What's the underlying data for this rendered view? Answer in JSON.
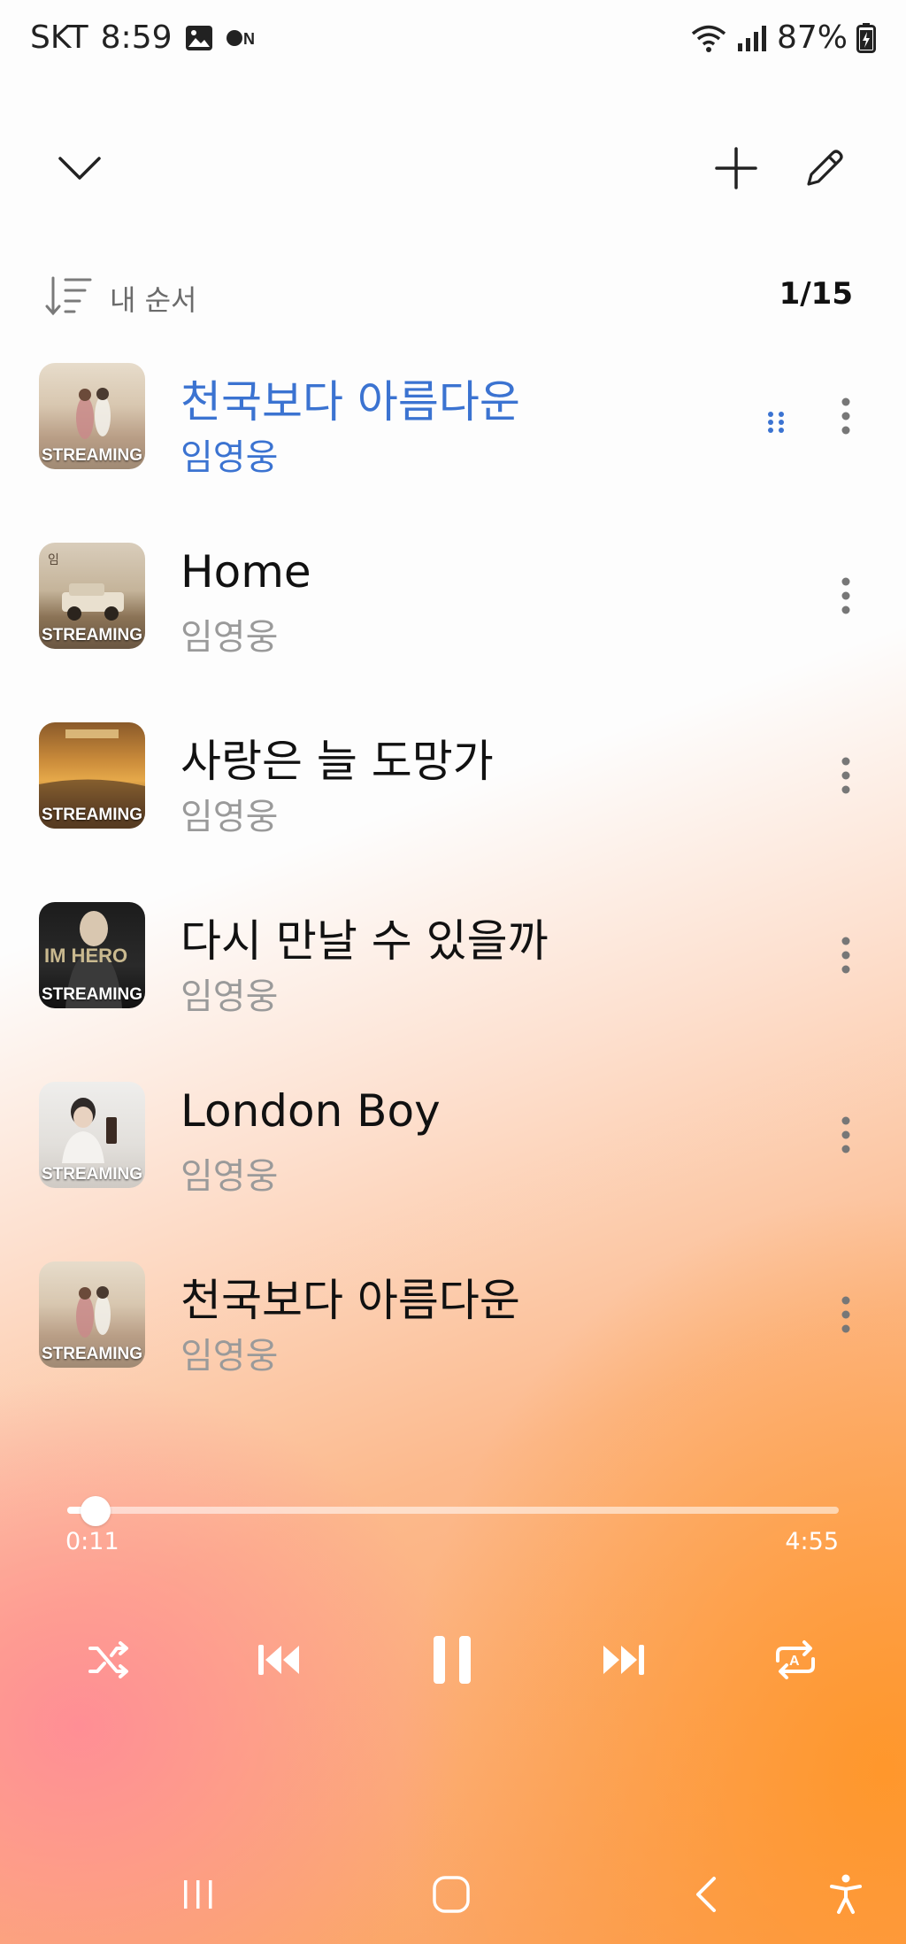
{
  "status_bar": {
    "carrier": "SKT",
    "time": "8:59",
    "battery": "87%",
    "icons": [
      "gallery-icon",
      "on-icon",
      "wifi-icon",
      "signal-icon",
      "battery-icon"
    ]
  },
  "toolbar": {
    "icons": [
      "chevron-down-icon",
      "plus-icon",
      "pencil-icon"
    ]
  },
  "sort": {
    "label": "내 순서",
    "count": "1/15"
  },
  "tracks": [
    {
      "title": "천국보다 아름다운",
      "artist": "임영웅",
      "badge": "STREAMING",
      "active": true
    },
    {
      "title": "Home",
      "artist": "임영웅",
      "badge": "STREAMING",
      "active": false
    },
    {
      "title": "사랑은 늘 도망가",
      "artist": "임영웅",
      "badge": "STREAMING",
      "active": false
    },
    {
      "title": "다시 만날 수 있을까",
      "artist": "임영웅",
      "badge": "STREAMING",
      "active": false
    },
    {
      "title": "London Boy",
      "artist": "임영웅",
      "badge": "STREAMING",
      "active": false
    },
    {
      "title": "천국보다 아름다운",
      "artist": "임영웅",
      "badge": "STREAMING",
      "active": false
    }
  ],
  "player": {
    "current_time": "0:11",
    "total_time": "4:55",
    "progress_fraction": 0.037,
    "controls": [
      "shuffle-icon",
      "previous-icon",
      "pause-icon",
      "next-icon",
      "repeat-a-icon"
    ]
  },
  "colors": {
    "accent": "#3b73d1",
    "secondary_text": "#9a9a9a"
  }
}
